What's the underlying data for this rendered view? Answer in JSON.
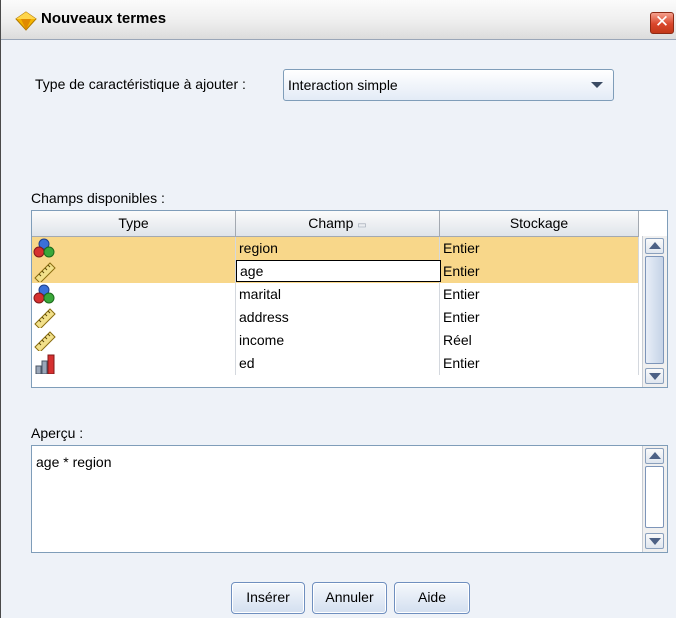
{
  "dialog": {
    "title": "Nouveaux termes",
    "close_label": "✕"
  },
  "feature_type": {
    "label": "Type de caractéristique à ajouter :",
    "value": "Interaction simple"
  },
  "fields": {
    "label": "Champs disponibles :",
    "columns": [
      "Type",
      "Champ",
      "Stockage"
    ],
    "sort_indicator": "▭",
    "rows": [
      {
        "type_icon": "nominal-icon",
        "champ": "region",
        "stockage": "Entier",
        "selected": true
      },
      {
        "type_icon": "ruler-icon",
        "champ": "age",
        "stockage": "Entier",
        "selected": true
      },
      {
        "type_icon": "nominal-icon",
        "champ": "marital",
        "stockage": "Entier",
        "selected": false
      },
      {
        "type_icon": "ruler-icon",
        "champ": "address",
        "stockage": "Entier",
        "selected": false
      },
      {
        "type_icon": "ruler-icon",
        "champ": "income",
        "stockage": "Réel",
        "selected": false
      },
      {
        "type_icon": "ordinal-icon",
        "champ": "ed",
        "stockage": "Entier",
        "selected": false
      }
    ]
  },
  "preview": {
    "label": "Aperçu :",
    "value": "age * region"
  },
  "buttons": {
    "insert": "Insérer",
    "cancel": "Annuler",
    "help": "Aide"
  },
  "colors": {
    "selected_row": "#f8d78a",
    "accent_border": "#7f9db9"
  }
}
